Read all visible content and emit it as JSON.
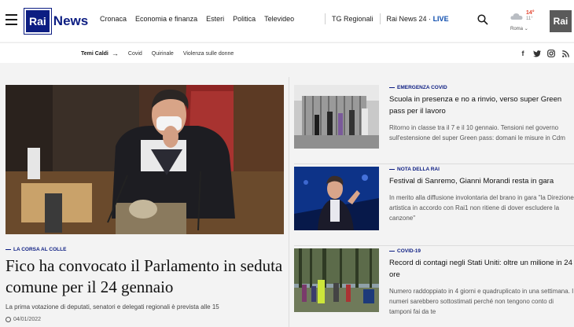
{
  "header": {
    "logo_rai": "Rai",
    "logo_news": "News",
    "nav": [
      "Cronaca",
      "Economia e finanza",
      "Esteri",
      "Politica",
      "Televideo"
    ],
    "tg_regionali": "TG Regionali",
    "rainews24": "Rai News 24 · ",
    "live": "LIVE",
    "weather": {
      "temp_max": "14°",
      "temp_min": "11°",
      "city": "Roma",
      "icon": "cloud-icon"
    },
    "rai_logo": "Rai"
  },
  "subbar": {
    "temi_label": "Temi Caldi",
    "topics": [
      "Covid",
      "Quirinale",
      "Violenza sulle donne"
    ],
    "social_icons": [
      "facebook-icon",
      "twitter-icon",
      "instagram-icon",
      "rss-icon"
    ]
  },
  "main_article": {
    "kicker": "LA CORSA AL COLLE",
    "title": "Fico ha convocato il Parlamento in seduta comune per il 24 gennaio",
    "summary": "La prima votazione di deputati, senatori e delegati regionali è prevista alle 15",
    "date": "04/01/2022"
  },
  "side_articles": [
    {
      "kicker": "EMERGENZA COVID",
      "title": "Scuola in presenza e no a rinvio, verso super Green pass per il lavoro",
      "summary": "Ritorno in classe tra il 7 e il 10 gennaio. Tensioni nel governo sull'estensione del super Green pass: domani le misure in Cdm"
    },
    {
      "kicker": "NOTA DELLA RAI",
      "title": "Festival di Sanremo, Gianni Morandi resta in gara",
      "summary": "In merito alla diffusione involontaria del brano in gara \"la Direzione artistica in accordo con Rai1 non ritiene di dover escludere la canzone\""
    },
    {
      "kicker": "COVID-19",
      "title": "Record di contagi negli Stati Uniti: oltre un milione in 24 ore",
      "summary": "Numero raddoppiato in 4 giorni e quadruplicato in una settimana. I numeri sarebbero sottostimati perché non tengono conto di tamponi fai da te"
    }
  ]
}
